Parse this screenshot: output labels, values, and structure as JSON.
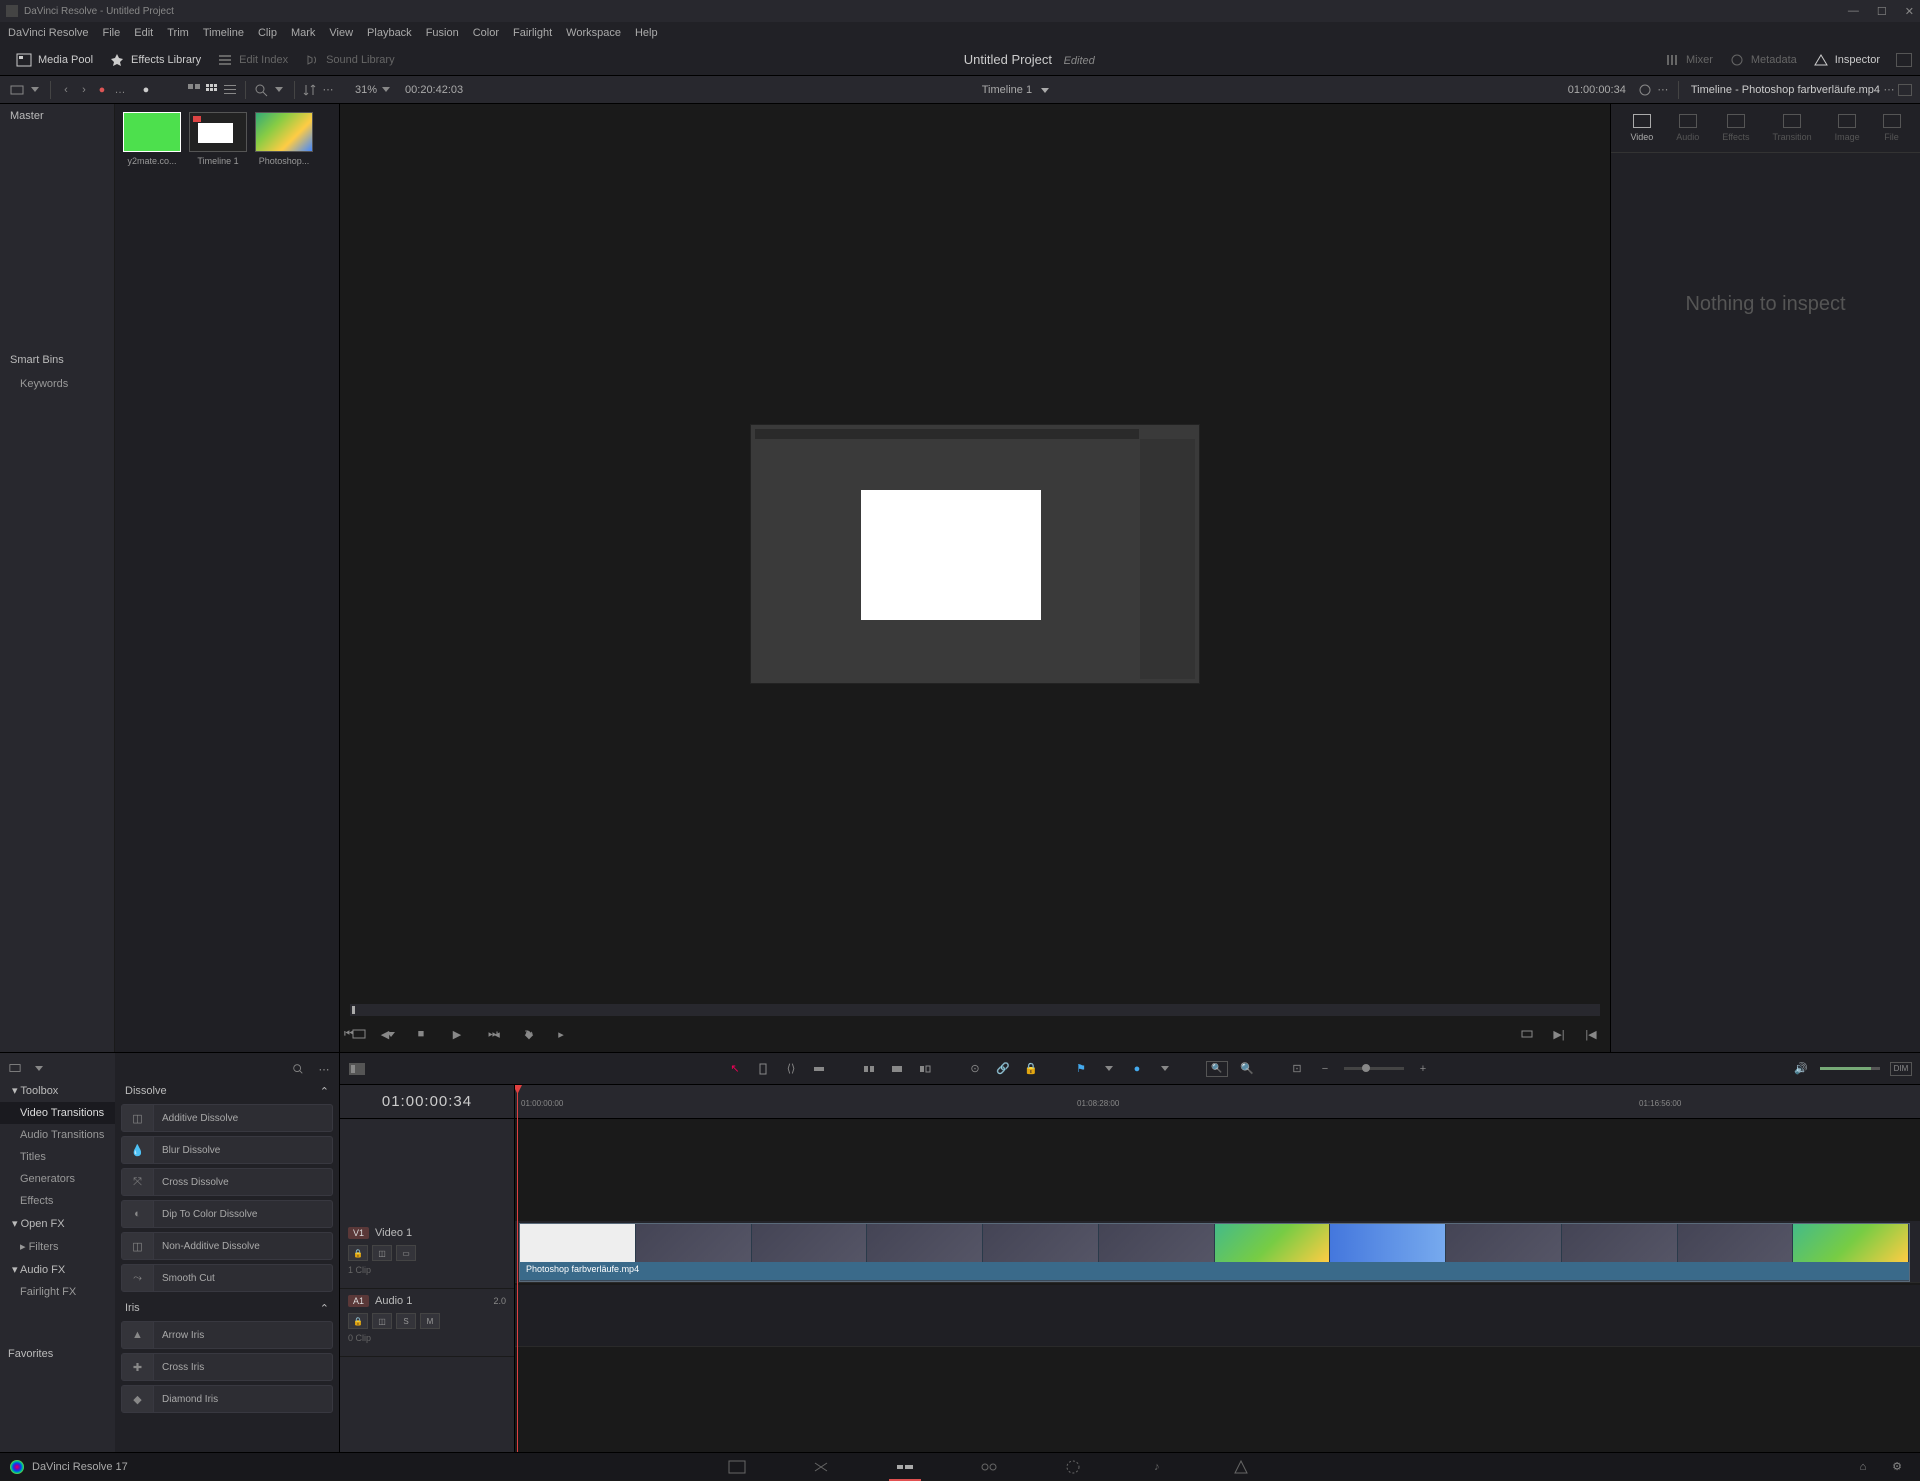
{
  "title_bar": "DaVinci Resolve - Untitled Project",
  "menu": [
    "DaVinci Resolve",
    "File",
    "Edit",
    "Trim",
    "Timeline",
    "Clip",
    "Mark",
    "View",
    "Playback",
    "Fusion",
    "Color",
    "Fairlight",
    "Workspace",
    "Help"
  ],
  "toolbar": {
    "media_pool": "Media Pool",
    "effects_library": "Effects Library",
    "edit_index": "Edit Index",
    "sound_library": "Sound Library",
    "project": "Untitled Project",
    "edited": "Edited",
    "mixer": "Mixer",
    "metadata": "Metadata",
    "inspector": "Inspector"
  },
  "subbar": {
    "zoom_pct": "31%",
    "source_tc": "00:20:42:03",
    "timeline_name": "Timeline 1",
    "record_tc": "01:00:00:34",
    "inspector_title": "Timeline - Photoshop farbverläufe.mp4"
  },
  "bins": {
    "master": "Master",
    "smart_bins": "Smart Bins",
    "keywords": "Keywords"
  },
  "clips": [
    {
      "label": "y2mate.co..."
    },
    {
      "label": "Timeline 1"
    },
    {
      "label": "Photoshop..."
    }
  ],
  "inspector": {
    "tabs": [
      "Video",
      "Audio",
      "Effects",
      "Transition",
      "Image",
      "File"
    ],
    "empty": "Nothing to inspect"
  },
  "fx_tree": {
    "toolbox": "Toolbox",
    "items": [
      "Video Transitions",
      "Audio Transitions",
      "Titles",
      "Generators",
      "Effects"
    ],
    "openfx": "Open FX",
    "filters": "Filters",
    "audiofx": "Audio FX",
    "fairlight": "Fairlight FX",
    "favorites": "Favorites"
  },
  "fx_groups": {
    "dissolve": "Dissolve",
    "dissolve_items": [
      "Additive Dissolve",
      "Blur Dissolve",
      "Cross Dissolve",
      "Dip To Color Dissolve",
      "Non-Additive Dissolve",
      "Smooth Cut"
    ],
    "iris": "Iris",
    "iris_items": [
      "Arrow Iris",
      "Cross Iris",
      "Diamond Iris"
    ]
  },
  "timeline": {
    "tc": "01:00:00:34",
    "ruler": [
      "01:00:00:00",
      "01:08:28:00",
      "01:16:56:00"
    ],
    "v1_badge": "V1",
    "v1_name": "Video 1",
    "v1_clips": "1 Clip",
    "a1_badge": "A1",
    "a1_name": "Audio 1",
    "a1_db": "2.0",
    "a1_clips": "0 Clip",
    "a1_s": "S",
    "a1_m": "M",
    "clip_name": "Photoshop farbverläufe.mp4"
  },
  "bottom": {
    "version": "DaVinci Resolve 17"
  }
}
